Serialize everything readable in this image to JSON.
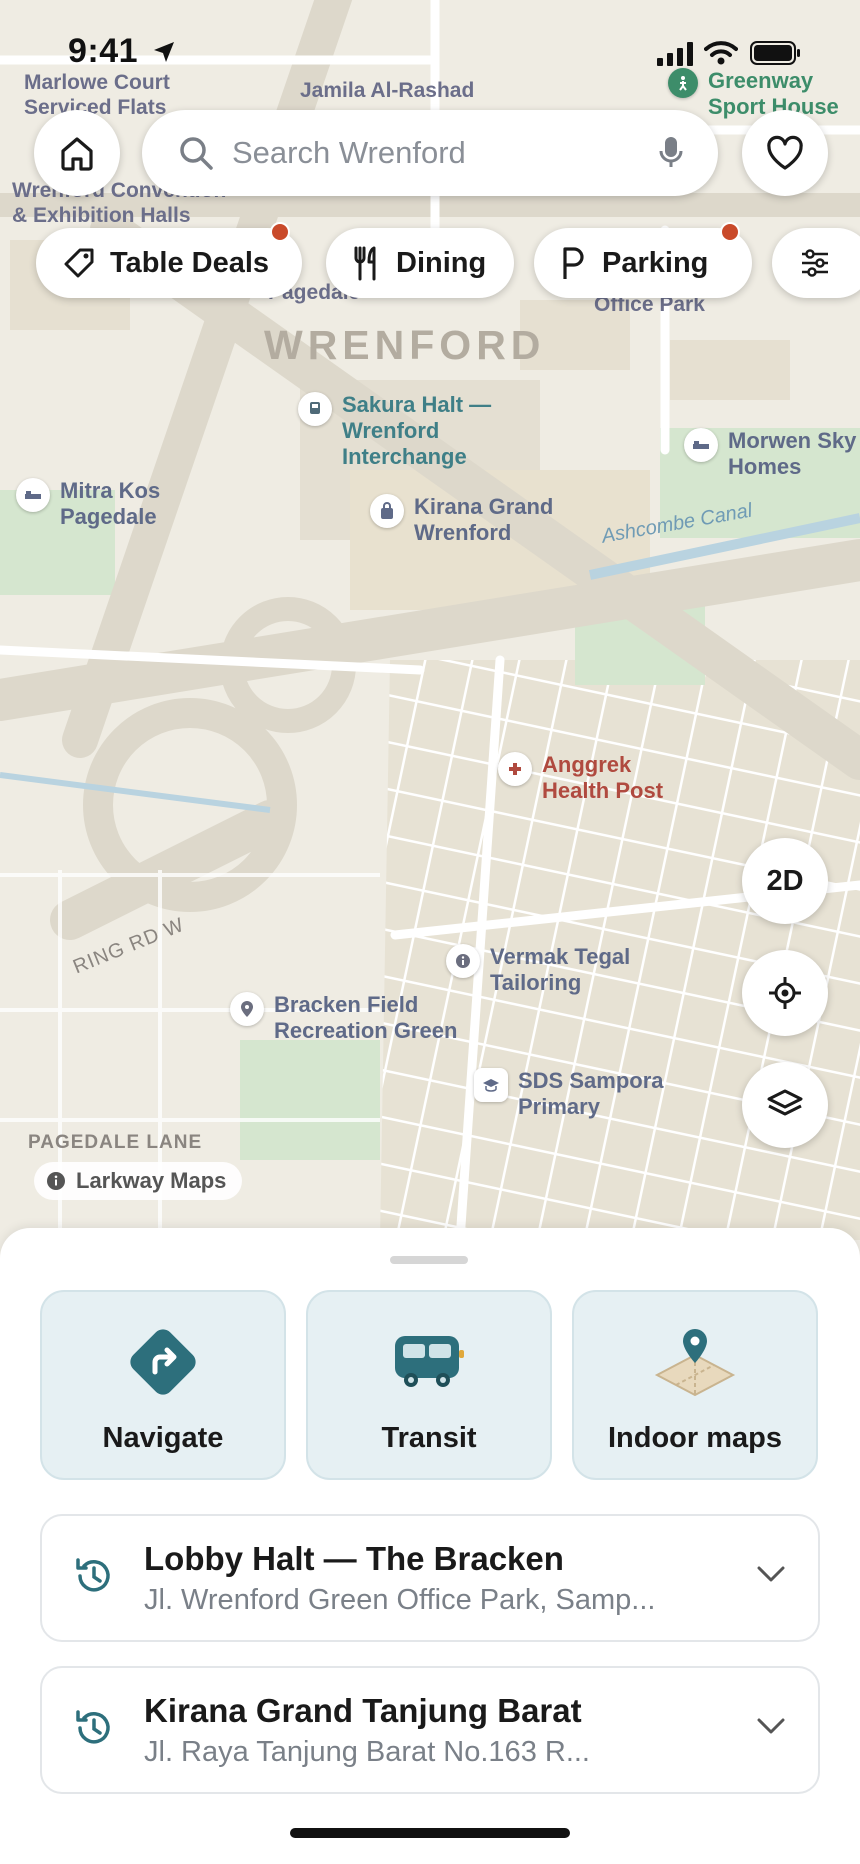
{
  "status_bar": {
    "time": "9:41"
  },
  "search": {
    "placeholder": "Search Wrenford"
  },
  "chips": [
    {
      "label": "Table Deals",
      "icon": "tag-icon",
      "has_dot": true
    },
    {
      "label": "Dining",
      "icon": "fork-knife-icon",
      "has_dot": false
    },
    {
      "label": "Parking",
      "icon": "parking-icon",
      "has_dot": true
    }
  ],
  "map": {
    "district": "WRENFORD",
    "labels": {
      "marlowe": "Marlowe Court Serviced Flats",
      "jamila": "Jamila Al-Rashad",
      "convention": "Wrenford Convention & Exhibition Halls",
      "office": "Office Park",
      "pagedale_partial": "Pagedale",
      "canal": "Ashcombe Canal",
      "ring_rd": "RING RD W",
      "pagedale_lane": "PAGEDALE LANE"
    },
    "pois": {
      "greenway": "Greenway Sport House",
      "sakura": "Sakura Halt — Wrenford Interchange",
      "morwen": "Morwen Sky Homes",
      "mitra": "Mitra Kos Pagedale",
      "kirana": "Kirana Grand Wrenford",
      "anggrek": "Anggrek Health Post",
      "vermak": "Vermak Tegal Tailoring",
      "bracken": "Bracken Field Recreation Green",
      "sds": "SDS Sampora Primary"
    },
    "view_mode": "2D",
    "attribution": "Larkway Maps"
  },
  "sheet": {
    "tiles": [
      {
        "label": "Navigate",
        "icon": "navigate-icon"
      },
      {
        "label": "Transit",
        "icon": "bus-icon"
      },
      {
        "label": "Indoor maps",
        "icon": "indoor-map-icon"
      }
    ],
    "recents": [
      {
        "title": "Lobby Halt — The Bracken",
        "subtitle": "Jl. Wrenford Green Office Park, Samp..."
      },
      {
        "title": "Kirana Grand Tanjung Barat",
        "subtitle": "Jl. Raya Tanjung Barat No.163 R..."
      }
    ]
  },
  "colors": {
    "accent": "#2d6f7c",
    "dot": "#c94a2a",
    "map_bg": "#efece3",
    "park": "#d5e6cf"
  }
}
